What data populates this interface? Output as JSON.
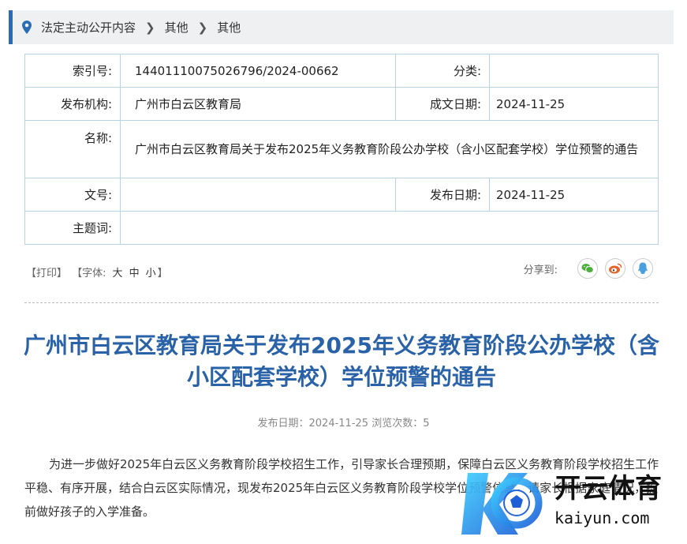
{
  "breadcrumb": {
    "items": [
      "法定主动公开内容",
      "其他",
      "其他"
    ]
  },
  "meta": {
    "index_label": "索引号:",
    "index_value": "144011100750267​96/2024-00662",
    "category_label": "分类:",
    "category_value": "",
    "publisher_label": "发布机构:",
    "publisher_value": "广州市白云区教育局",
    "written_date_label": "成文日期:",
    "written_date_value": "2024-11-25",
    "name_label": "名称:",
    "name_value": "广州市白云区教育局关于发布2025年义务教育阶段公办学校（含小区配套学校）学位预警的通告",
    "docno_label": "文号:",
    "docno_value": "",
    "pub_date_label": "发布日期:",
    "pub_date_value": "2024-11-25",
    "subject_label": "主题词:",
    "subject_value": ""
  },
  "toolbar": {
    "print": "【打印】",
    "font_open": "【字体:",
    "font_large": "大",
    "font_medium": "中",
    "font_small": "小",
    "font_close": "】",
    "share_label": "分享到:"
  },
  "article": {
    "title": "广州市白云区教育局关于发布2025年义务教育阶段公办学校（含小区配套学校）学位预警的通告",
    "pub_info": "发布日期：2024-11-25   浏览次数：5",
    "paragraph": "为进一步做好2025年白云区义务教育阶段学校招生工作，引导家长合理预期，保障白云区义务教育阶段学校招生工作平稳、有序开展，结合白云区实际情况，现发布2025年白云区义务教育阶段学校学位预警信息，请家长根据家庭情况，提前做好孩子的入学准备。"
  },
  "watermark": {
    "brand": "开云体育",
    "domain": "kaiyun.com"
  },
  "colors": {
    "accent": "#2a6db5",
    "title": "#2a62a8",
    "wechat": "#4caf3c",
    "weibo": "#e5642b",
    "qq": "#4a9fe0"
  }
}
